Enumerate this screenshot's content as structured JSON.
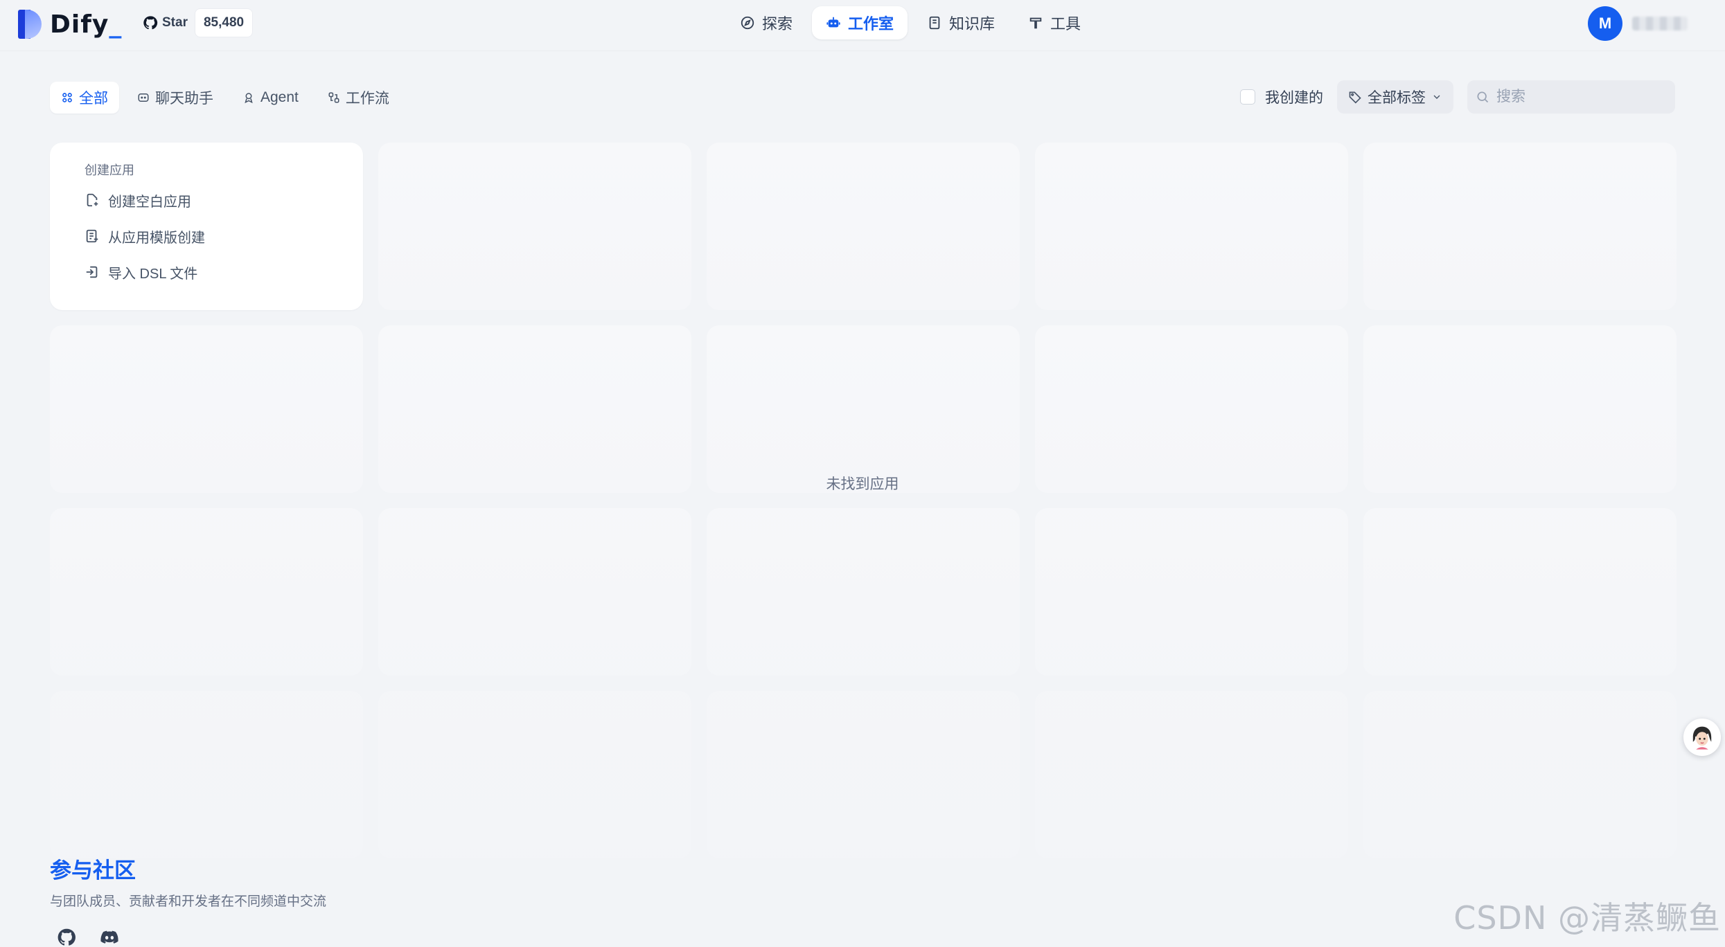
{
  "brand": {
    "name": "Dify",
    "suffix": "_"
  },
  "github": {
    "star_label": "Star",
    "star_count": "85,480"
  },
  "nav": {
    "items": [
      {
        "label": "探索",
        "icon": "compass-icon"
      },
      {
        "label": "工作室",
        "icon": "robot-icon",
        "active": true
      },
      {
        "label": "知识库",
        "icon": "book-icon"
      },
      {
        "label": "工具",
        "icon": "hammer-icon"
      }
    ]
  },
  "user": {
    "initial": "M"
  },
  "tabs": [
    {
      "label": "全部",
      "icon": "grid-icon",
      "active": true
    },
    {
      "label": "聊天助手",
      "icon": "chat-bubble-icon"
    },
    {
      "label": "Agent",
      "icon": "agent-icon"
    },
    {
      "label": "工作流",
      "icon": "workflow-icon"
    }
  ],
  "filters": {
    "mine_label": "我创建的",
    "tag_label": "全部标签",
    "search_placeholder": "搜索"
  },
  "create": {
    "title": "创建应用",
    "options": [
      {
        "label": "创建空白应用",
        "icon": "file-plus-icon"
      },
      {
        "label": "从应用模版创建",
        "icon": "template-icon"
      },
      {
        "label": "导入 DSL 文件",
        "icon": "import-icon"
      }
    ]
  },
  "empty_state": "未找到应用",
  "community": {
    "title": "参与社区",
    "description": "与团队成员、贡献者和开发者在不同频道中交流",
    "links": [
      "github-icon",
      "discord-icon"
    ]
  },
  "watermark": "CSDN @清蒸鳜鱼",
  "colors": {
    "accent": "#155eef",
    "background": "#f2f4f7",
    "card": "#ffffff"
  }
}
